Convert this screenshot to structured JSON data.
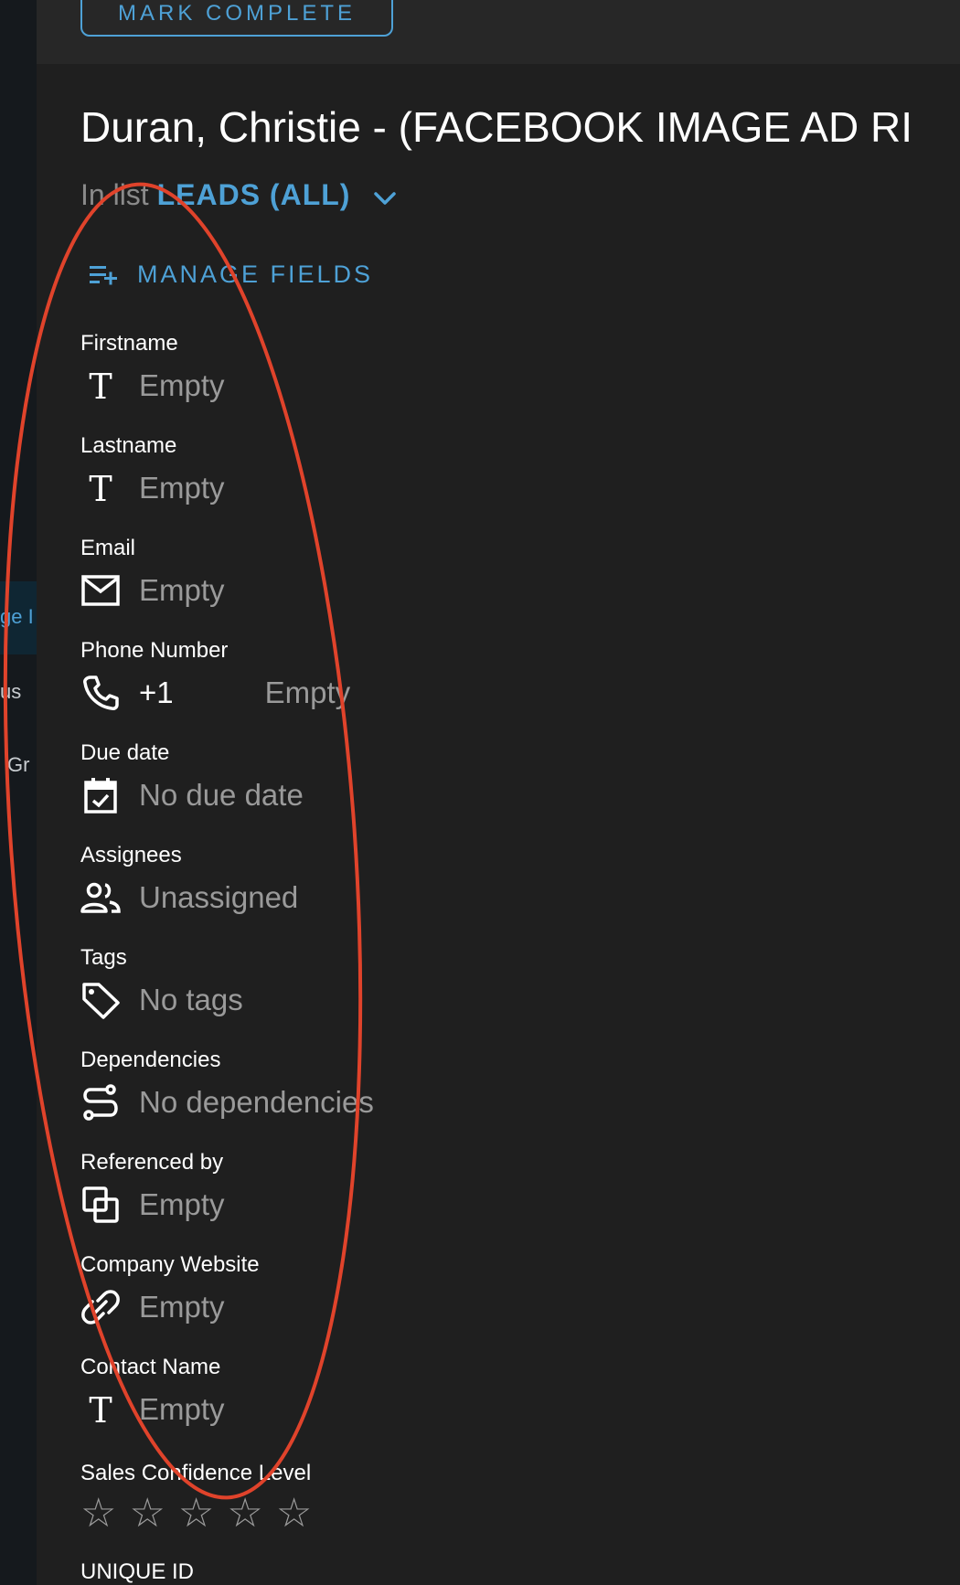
{
  "colors": {
    "accent": "#4ea1d6",
    "background": "#1f1f1f",
    "muted": "#9a9a9a",
    "annotation": "#e0432b"
  },
  "sidebar": {
    "items": [
      "ge I",
      "us",
      "Gr"
    ]
  },
  "toolbar": {
    "mark_complete_label": "MARK COMPLETE"
  },
  "record": {
    "title": "Duran, Christie - (FACEBOOK IMAGE AD RI",
    "in_list_prefix": "In list",
    "list_name": "LEADS (ALL)"
  },
  "manage_fields_label": "MANAGE FIELDS",
  "fields": [
    {
      "label": "Firstname",
      "value": "Empty",
      "icon": "text-icon"
    },
    {
      "label": "Lastname",
      "value": "Empty",
      "icon": "text-icon"
    },
    {
      "label": "Email",
      "value": "Empty",
      "icon": "mail-icon"
    },
    {
      "label": "Phone Number",
      "value": "Empty",
      "prefix": "+1",
      "icon": "phone-icon"
    },
    {
      "label": "Due date",
      "value": "No due date",
      "icon": "calendar-check-icon"
    },
    {
      "label": "Assignees",
      "value": "Unassigned",
      "icon": "people-icon"
    },
    {
      "label": "Tags",
      "value": "No tags",
      "icon": "tag-icon"
    },
    {
      "label": "Dependencies",
      "value": "No dependencies",
      "icon": "dependencies-icon"
    },
    {
      "label": "Referenced by",
      "value": "Empty",
      "icon": "reference-icon"
    },
    {
      "label": "Company Website",
      "value": "Empty",
      "icon": "link-icon"
    },
    {
      "label": "Contact Name",
      "value": "Empty",
      "icon": "text-icon"
    },
    {
      "label": "Sales Confidence Level",
      "rating": 0,
      "max_rating": 5,
      "icon": "star-icon"
    },
    {
      "label": "UNIQUE ID"
    }
  ]
}
